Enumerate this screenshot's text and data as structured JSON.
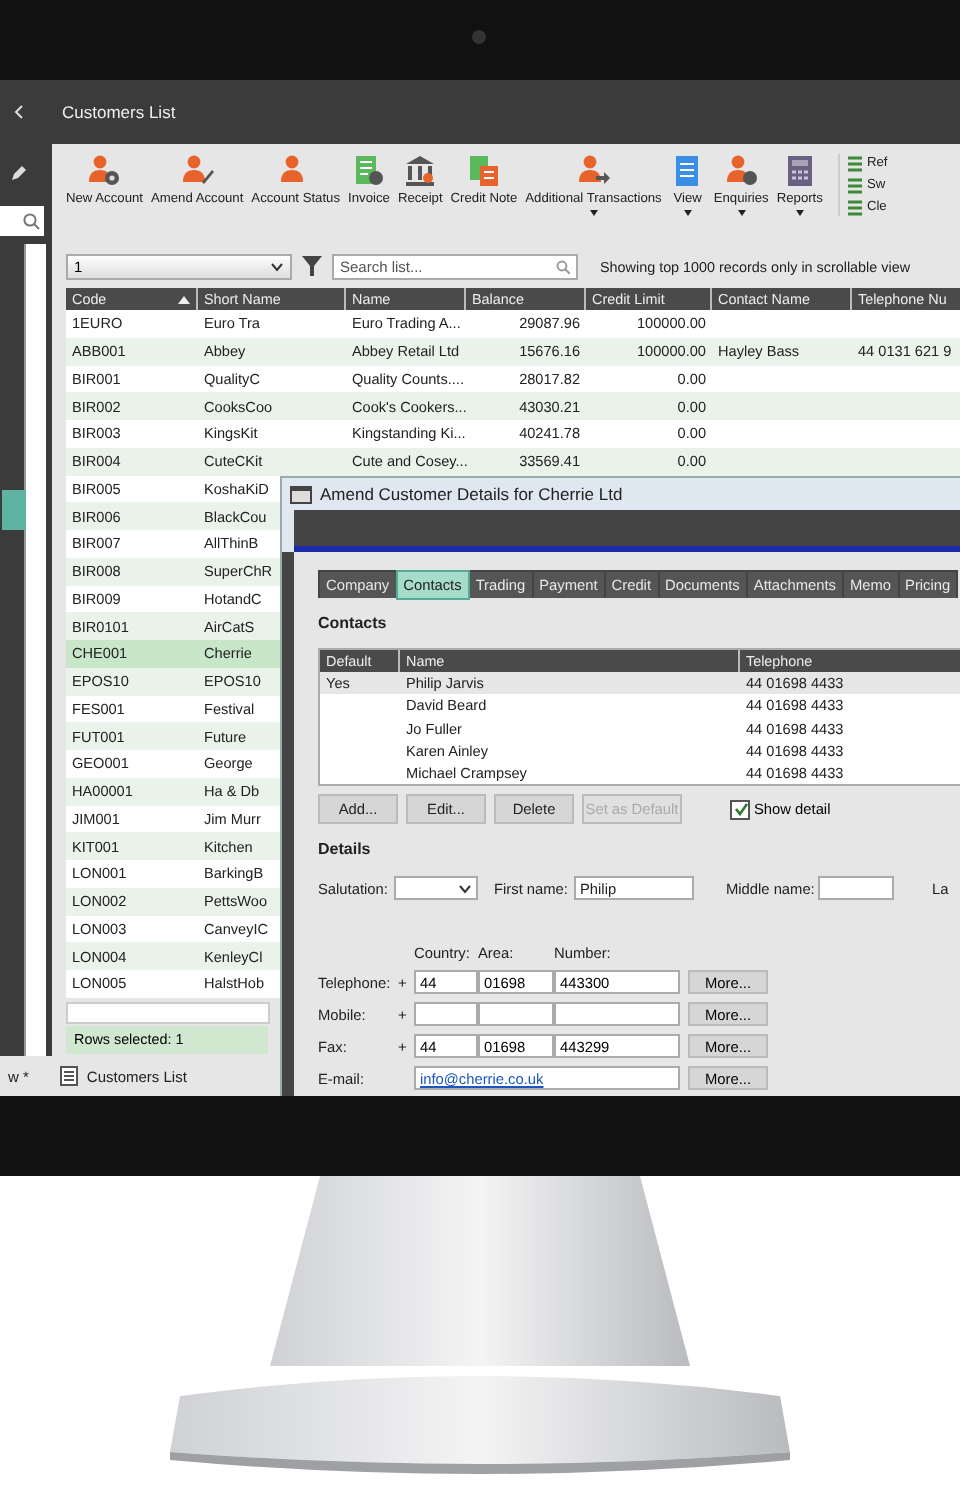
{
  "window": {
    "title": "Customers List"
  },
  "toolbar": [
    {
      "label": "New Account",
      "dropdown": false
    },
    {
      "label": "Amend Account",
      "dropdown": false
    },
    {
      "label": "Account Status",
      "dropdown": false
    },
    {
      "label": "Invoice",
      "dropdown": false
    },
    {
      "label": "Receipt",
      "dropdown": false
    },
    {
      "label": "Credit Note",
      "dropdown": false
    },
    {
      "label": "Additional Transactions",
      "dropdown": true
    },
    {
      "label": "View",
      "dropdown": true
    },
    {
      "label": "Enquiries",
      "dropdown": true
    },
    {
      "label": "Reports",
      "dropdown": true
    }
  ],
  "side_actions": [
    "Ref",
    "Sw",
    "Cle"
  ],
  "filter": {
    "value": "1",
    "search_placeholder": "Search list...",
    "note": "Showing top 1000 records only in scrollable view"
  },
  "table": {
    "columns": [
      {
        "label": "Code",
        "sorted": true
      },
      {
        "label": "Short Name",
        "sorted": false
      },
      {
        "label": "Name",
        "sorted": false
      },
      {
        "label": "Balance",
        "sorted": false
      },
      {
        "label": "Credit Limit",
        "sorted": false
      },
      {
        "label": "Contact Name",
        "sorted": false
      },
      {
        "label": "Telephone Nu",
        "sorted": false
      }
    ],
    "rows": [
      {
        "code": "1EURO",
        "short_name": "Euro Tra",
        "name": "Euro Trading A...",
        "balance": "29087.96",
        "credit_limit": "100000.00",
        "selected": false
      },
      {
        "code": "ABB001",
        "short_name": "Abbey",
        "name": "Abbey Retail Ltd",
        "balance": "15676.16",
        "credit_limit": "100000.00",
        "contact_name": "Hayley Bass",
        "telephone": "44 0131 621 9",
        "selected": false
      },
      {
        "code": "BIR001",
        "short_name": "QualityC",
        "name": "Quality Counts....",
        "balance": "28017.82",
        "credit_limit": "0.00",
        "selected": false
      },
      {
        "code": "BIR002",
        "short_name": "CooksCoo",
        "name": "Cook's Cookers...",
        "balance": "43030.21",
        "credit_limit": "0.00",
        "selected": false
      },
      {
        "code": "BIR003",
        "short_name": "KingsKit",
        "name": "Kingstanding Ki...",
        "balance": "40241.78",
        "credit_limit": "0.00",
        "selected": false
      },
      {
        "code": "BIR004",
        "short_name": "CuteCKit",
        "name": "Cute and Cosey...",
        "balance": "33569.41",
        "credit_limit": "0.00",
        "selected": false
      },
      {
        "code": "BIR005",
        "short_name": "KoshaKiD",
        "selected": false
      },
      {
        "code": "BIR006",
        "short_name": "BlackCou",
        "selected": false
      },
      {
        "code": "BIR007",
        "short_name": "AllThinB",
        "selected": false
      },
      {
        "code": "BIR008",
        "short_name": "SuperChR",
        "selected": false
      },
      {
        "code": "BIR009",
        "short_name": "HotandC",
        "selected": false
      },
      {
        "code": "BIR0101",
        "short_name": "AirCatS",
        "selected": false
      },
      {
        "code": "CHE001",
        "short_name": "Cherrie",
        "selected": true
      },
      {
        "code": "EPOS10",
        "short_name": "EPOS10",
        "selected": false
      },
      {
        "code": "FES001",
        "short_name": "Festival",
        "selected": false
      },
      {
        "code": "FUT001",
        "short_name": "Future",
        "selected": false
      },
      {
        "code": "GEO001",
        "short_name": "George",
        "selected": false
      },
      {
        "code": "HA00001",
        "short_name": "Ha & Db",
        "selected": false
      },
      {
        "code": "JIM001",
        "short_name": "Jim Murr",
        "selected": false
      },
      {
        "code": "KIT001",
        "short_name": "Kitchen",
        "selected": false
      },
      {
        "code": "LON001",
        "short_name": "BarkingB",
        "selected": false
      },
      {
        "code": "LON002",
        "short_name": "PettsWoo",
        "selected": false
      },
      {
        "code": "LON003",
        "short_name": "CanveyIC",
        "selected": false
      },
      {
        "code": "LON004",
        "short_name": "KenleyCl",
        "selected": false
      },
      {
        "code": "LON005",
        "short_name": "HalstHob",
        "selected": false
      }
    ]
  },
  "status_bar": "Rows selected: 1",
  "taskbar": [
    {
      "label": "w *"
    },
    {
      "label": "Customers List"
    }
  ],
  "dialog": {
    "title": "Amend Customer Details for Cherrie Ltd",
    "tabs": [
      {
        "label": "Company",
        "selected": false
      },
      {
        "label": "Contacts",
        "selected": true
      },
      {
        "label": "Trading",
        "selected": false
      },
      {
        "label": "Payment",
        "selected": false
      },
      {
        "label": "Credit",
        "selected": false
      },
      {
        "label": "Documents",
        "selected": false
      },
      {
        "label": "Attachments",
        "selected": false
      },
      {
        "label": "Memo",
        "selected": false
      },
      {
        "label": "Pricing",
        "selected": false
      }
    ],
    "contacts_heading": "Contacts",
    "contacts_columns": [
      "Default",
      "Name",
      "Telephone"
    ],
    "contacts": [
      {
        "default": "Yes",
        "name": "Philip Jarvis",
        "telephone": "44 01698 4433",
        "selected": true
      },
      {
        "name": "David Beard",
        "telephone": "44 01698 4433",
        "selected": false
      },
      {
        "name": "Jo Fuller",
        "telephone": "44 01698 4433",
        "selected": false
      },
      {
        "name": "Karen Ainley",
        "telephone": "44 01698 4433",
        "selected": false
      },
      {
        "name": "Michael Crampsey",
        "telephone": "44 01698 4433",
        "selected": false
      }
    ],
    "buttons": [
      {
        "label": "Add...",
        "disabled": false
      },
      {
        "label": "Edit...",
        "disabled": false
      },
      {
        "label": "Delete",
        "disabled": false
      },
      {
        "label": "Set as Default",
        "disabled": true
      }
    ],
    "show_detail": {
      "label": "Show detail",
      "checked": true
    },
    "details_heading": "Details",
    "salutation_label": "Salutation:",
    "first_name": {
      "label": "First name:",
      "value": "Philip"
    },
    "middle_name": {
      "label": "Middle name:"
    },
    "last_name_label": "La",
    "phone_headers": [
      "Country:",
      "Area:",
      "Number:"
    ],
    "phones": [
      {
        "label": "Telephone:",
        "plus": "+",
        "country": "44",
        "area": "01698",
        "number": "443300",
        "more": "More..."
      },
      {
        "label": "Mobile:",
        "plus": "+",
        "more": "More..."
      },
      {
        "label": "Fax:",
        "plus": "+",
        "country": "44",
        "area": "01698",
        "number": "443299",
        "more": "More..."
      }
    ],
    "email": {
      "label": "E-mail:",
      "value": "info@cherrie.co.uk",
      "more": "More..."
    }
  }
}
